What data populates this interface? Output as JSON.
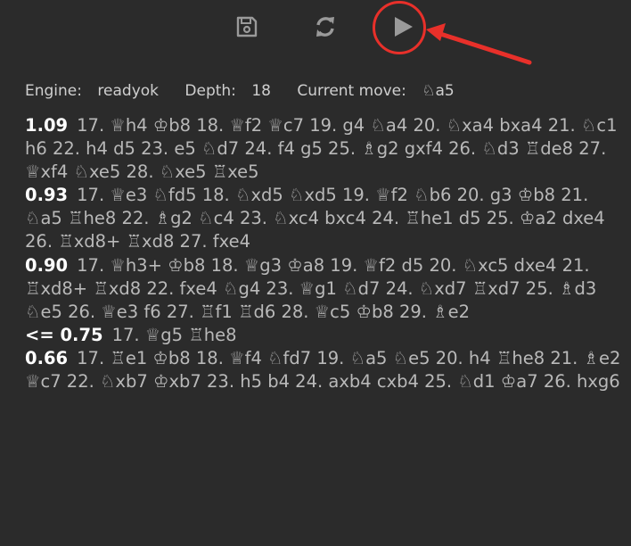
{
  "toolbar": {
    "buttons": [
      {
        "name": "save",
        "icon": "floppy-disk-icon"
      },
      {
        "name": "refresh",
        "icon": "refresh-icon"
      },
      {
        "name": "play",
        "icon": "play-icon"
      }
    ],
    "highlight_color": "#e8302a",
    "icon_color": "#9a9a9a"
  },
  "status": {
    "engine_label": "Engine:",
    "engine_value": "readyok",
    "depth_label": "Depth:",
    "depth_value": "18",
    "current_move_label": "Current move:",
    "current_move_value": "♘a5"
  },
  "lines": [
    {
      "score": "1.09",
      "moves": "17. ♕h4 ♔b8 18. ♕f2 ♕c7 19. g4 ♘a4 20. ♘xa4 bxa4 21. ♘c1 h6 22. h4 d5 23. e5 ♘d7 24. f4 g5 25. ♗g2 gxf4 26. ♘d3 ♖de8 27. ♕xf4 ♘xe5 28. ♘xe5 ♖xe5"
    },
    {
      "score": "0.93",
      "moves": "17. ♕e3 ♘fd5 18. ♘xd5 ♘xd5 19. ♕f2 ♘b6 20. g3 ♔b8 21. ♘a5 ♖he8 22. ♗g2 ♘c4 23. ♘xc4 bxc4 24. ♖he1 d5 25. ♔a2 dxe4 26. ♖xd8+ ♖xd8 27. fxe4"
    },
    {
      "score": "0.90",
      "moves": "17. ♕h3+ ♔b8 18. ♕g3 ♔a8 19. ♕f2 d5 20. ♘xc5 dxe4 21. ♖xd8+ ♖xd8 22. fxe4 ♘g4 23. ♕g1 ♘d7 24. ♘xd7 ♖xd7 25. ♗d3 ♘e5 26. ♕e3 f6 27. ♖f1 ♖d6 28. ♕c5 ♔b8 29. ♗e2"
    },
    {
      "score": "<= 0.75",
      "moves": "17. ♕g5 ♖he8"
    },
    {
      "score": "0.66",
      "moves": "17. ♖e1 ♔b8 18. ♕f4 ♘fd7 19. ♘a5 ♘e5 20. h4 ♖he8 21. ♗e2 ♕c7 22. ♘xb7 ♔xb7 23. h5 b4 24. axb4 cxb4 25. ♘d1 ♔a7 26. hxg6"
    }
  ]
}
